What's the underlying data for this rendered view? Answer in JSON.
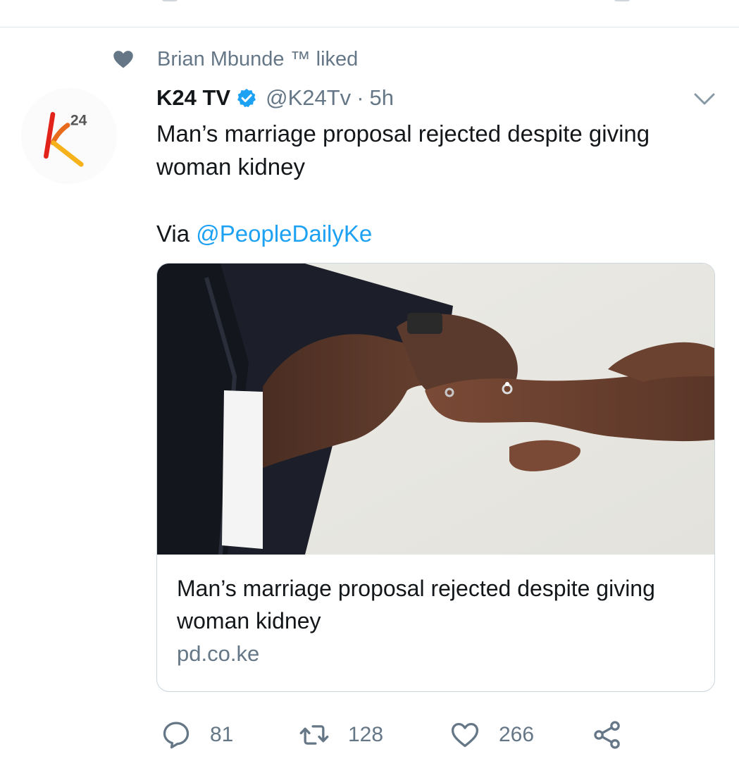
{
  "social_context": {
    "liker": "Brian Mbunde ™ liked"
  },
  "tweet": {
    "author_name": "K24 TV",
    "handle": "@K24Tv",
    "separator": "·",
    "time": "5h",
    "text": "Man’s marriage proposal rejected despite giving woman kidney",
    "via_prefix": "Via ",
    "via_mention": "@PeopleDailyKe"
  },
  "avatar": {
    "logo_text": "24"
  },
  "card": {
    "title": "Man’s marriage proposal rejected despite giving woman kidney",
    "domain": "pd.co.ke"
  },
  "actions": {
    "reply_count": "81",
    "retweet_count": "128",
    "like_count": "266"
  },
  "icons": {
    "social_heart": "heart-icon",
    "verified": "verified-badge-icon",
    "caret": "chevron-down-icon",
    "reply": "reply-icon",
    "retweet": "retweet-icon",
    "like": "like-icon",
    "share": "share-icon"
  },
  "colors": {
    "link": "#1da1f2",
    "secondary_text": "#657786",
    "primary_text": "#14171a",
    "border": "#ccd6dd",
    "logo_red": "#e2231a",
    "logo_yellow": "#f6b21b"
  }
}
